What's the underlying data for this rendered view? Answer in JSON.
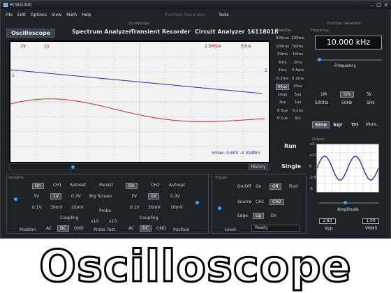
{
  "titlebar": {
    "title": "PCSU1000",
    "min": "–",
    "max": "□",
    "close": "×"
  },
  "menu": {
    "file": "File",
    "edit": "Edit",
    "options": "Options",
    "view": "View",
    "math": "Math",
    "help": "Help",
    "function_generator": "Function Generator",
    "tools": "Tools"
  },
  "section_labels": {
    "oscilloscope": "Oscilloscope",
    "function_generator": "Function Generator",
    "time_div": "Time/Div",
    "frequency": "Frequency",
    "volts_div": "Volts/Div",
    "trigger": "Trigger",
    "output": "Output"
  },
  "tabs": [
    {
      "label": "Oscilloscope"
    },
    {
      "label": "Spectrum Analyzer"
    },
    {
      "label": "Transient Recorder"
    },
    {
      "label": "Circuit Analyzer"
    },
    {
      "label": "16118018"
    }
  ],
  "screen": {
    "ch1_marker": "1V",
    "ch2_marker": "1V",
    "sample_rate": "2.5MS/s",
    "time_marker": "50us",
    "ch1_marker_right": "1",
    "readout": "Vmax: 0.60V    -2.30dBm",
    "colors": {
      "ch1": "#2a2ab0",
      "ch2": "#cc2a2a",
      "grid": "#9a9a9a"
    }
  },
  "history_label": "History",
  "timediv": {
    "cells": [
      [
        "500ms",
        "200ms"
      ],
      [
        "100ms",
        "50ms"
      ],
      [
        "20ms",
        "10ms"
      ],
      [
        "5ms",
        "2ms"
      ],
      [
        "1ms",
        "0.5ms"
      ],
      [
        "0.2ms",
        "0.1ms"
      ],
      [
        "50us",
        "20us"
      ],
      [
        "10us",
        "5us"
      ],
      [
        "2us",
        "1us"
      ],
      [
        "0.5us",
        "0.2us"
      ],
      [
        "0.1us",
        "S/s"
      ]
    ],
    "selected": "50us"
  },
  "run_label": "Run",
  "single_label": "Single",
  "fg": {
    "frequency_value": "10.000 kHz",
    "frequency_label": "Frequency",
    "ranges_row1": [
      "1M",
      "50k",
      "5k"
    ],
    "ranges_row2": [
      "500Hz",
      "50Hz",
      "5Hz"
    ],
    "selected_range": "50k",
    "waveforms": [
      "Sine",
      "Sqr",
      "Tri",
      "More.."
    ],
    "selected_waveform": "Sine",
    "output_ticks": [
      "+5",
      "+2.5",
      "0",
      "-2.5",
      "-5"
    ],
    "amplitude_label": "Amplitude",
    "vpp_value": "2.83",
    "vpp_label": "Vpp",
    "vrms_value": "1.00",
    "vrms_label": "VRMS"
  },
  "ch1": {
    "on_label": "On",
    "name": "CH1",
    "autoset": "Autoset",
    "row1": [
      "3V",
      "1V",
      "0.3V"
    ],
    "row2": [
      "0.1V",
      "30mV",
      "10mV"
    ],
    "selected": "1V",
    "coupling_label": "Coupling",
    "coupling": [
      "AC",
      "DC",
      "GND"
    ],
    "selected_coupling": "DC",
    "position_label": "Position"
  },
  "ch2": {
    "persist_label": "Persist",
    "on_label": "On",
    "name": "CH2",
    "autoset": "Autoset",
    "row1": [
      "3V",
      "1V",
      "0.3V"
    ],
    "row2": [
      "0.1V",
      "30mV",
      "10mV"
    ],
    "selected": "1V",
    "big_screen": "Big Screen",
    "coupling_label": "Coupling",
    "coupling": [
      "AC",
      "DC",
      "GND"
    ],
    "selected_coupling": "DC",
    "position_label": "Position",
    "probe_label": "Probe",
    "probe_x10a": "x10",
    "probe_x10b": "x10",
    "probe_test": "Probe Test"
  },
  "trigger": {
    "onoff_label": "On/Off",
    "on": "On",
    "off": "Off",
    "find": "Find",
    "source_label": "Source",
    "src_ch1": "CH1",
    "src_ch2": "CH2",
    "edge_label": "Edge",
    "up": "Up",
    "dn": "Dn",
    "level_label": "Level",
    "status": "Ready"
  },
  "banner": "Oscilloscope"
}
